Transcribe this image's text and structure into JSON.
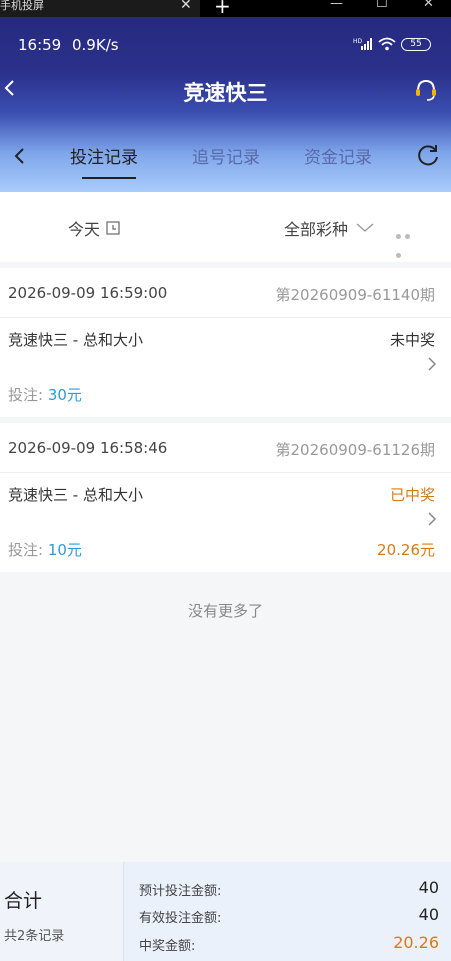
{
  "window": {
    "tab_title": "手机投屏",
    "tab_close": "✕",
    "new_tab": "+",
    "minimize": "—",
    "maximize": "☐",
    "close": "✕"
  },
  "status_bar": {
    "time": "16:59",
    "speed": "0.9K/s",
    "network": "HD",
    "battery": "55"
  },
  "nav": {
    "title": "竞速快三",
    "back_icon": "chevron-left-icon",
    "service_icon": "headset-icon"
  },
  "tabs": [
    {
      "label": "投注记录",
      "active": true
    },
    {
      "label": "追号记录",
      "active": false
    },
    {
      "label": "资金记录",
      "active": false
    }
  ],
  "filter": {
    "date": "今天",
    "lottery": "全部彩种"
  },
  "records": [
    {
      "time": "2026-09-09 16:59:00",
      "issue": "第20260909-61140期",
      "game": "竞速快三 - 总和大小",
      "status": "未中奖",
      "status_color": "#333333",
      "bet_label": "投注:",
      "bet_amount": "30元",
      "win_amount": ""
    },
    {
      "time": "2026-09-09 16:58:46",
      "issue": "第20260909-61126期",
      "game": "竞速快三 - 总和大小",
      "status": "已中奖",
      "status_color": "#d97a16",
      "bet_label": "投注:",
      "bet_amount": "10元",
      "win_amount": "20.26元"
    }
  ],
  "no_more": "没有更多了",
  "summary": {
    "title": "合计",
    "count": "共2条记录",
    "expected_label": "预计投注金额:",
    "expected_value": "40",
    "valid_label": "有效投注金额:",
    "valid_value": "40",
    "win_label": "中奖金额:",
    "win_value": "20.26"
  },
  "colors": {
    "accent_blue": "#2f9bd7",
    "win_orange": "#d97a16",
    "header_dark": "#26297e",
    "header_light": "#a9ccfb"
  }
}
